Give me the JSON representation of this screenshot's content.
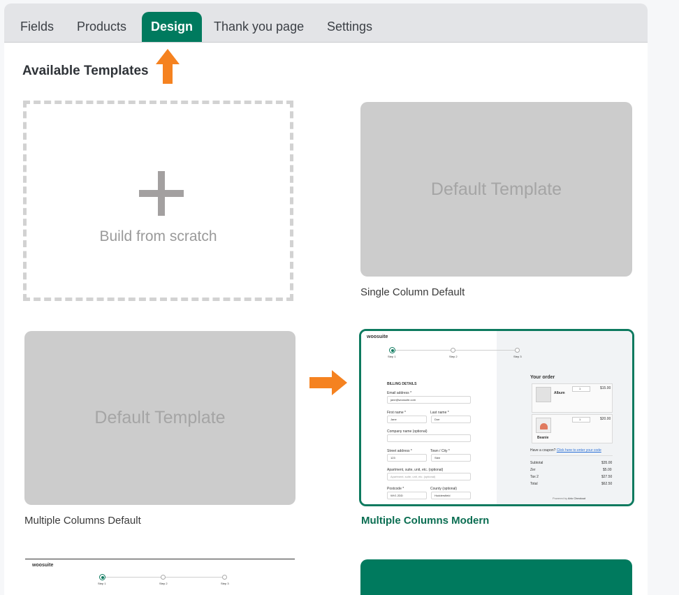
{
  "tabs": [
    {
      "label": "Fields"
    },
    {
      "label": "Products"
    },
    {
      "label": "Design"
    },
    {
      "label": "Thank you page"
    },
    {
      "label": "Settings"
    }
  ],
  "section_title": "Available Templates",
  "templates": {
    "scratch": {
      "label": "Build from scratch"
    },
    "single_default": {
      "placeholder": "Default Template",
      "caption": "Single Column Default"
    },
    "multi_default": {
      "placeholder": "Default Template",
      "caption": "Multiple Columns Default"
    },
    "multi_modern": {
      "caption": "Multiple Columns Modern"
    }
  },
  "preview": {
    "logo": "woosuite",
    "steps": [
      "Step 1",
      "Step 2",
      "Step 3"
    ],
    "billing_title": "BILLING DETAILS",
    "email_label": "Email address *",
    "email_value": "jane@woosuite.com",
    "first_label": "First name *",
    "first_value": "Jane",
    "last_label": "Last name *",
    "last_value": "Doe",
    "company_label": "Company name (optional)",
    "street_label": "Street address *",
    "street_value": "123",
    "town_label": "Town / City *",
    "town_value": "Stee",
    "apt_label": "Apartment, suite, unit, etc. (optional)",
    "apt_placeholder": "Apartment, suite, unit, etc. (optional)",
    "postcode_label": "Postcode *",
    "postcode_value": "WV1 2DD",
    "county_label": "County (optional)",
    "county_value": "Huddersfield",
    "order_title": "Your order",
    "item1_name": "Album",
    "item1_price": "$15.00",
    "item2_name": "Beanie",
    "item2_price": "$20.00",
    "qty": "1",
    "coupon_text": "Have a coupon?",
    "coupon_link": "Click here to enter your code",
    "subtotal_label": "Subtotal",
    "subtotal_value": "$35.00",
    "tax1_label": "Zer",
    "tax1_value": "$5.00",
    "tax2_label": "Tax 2",
    "tax2_value": "$27.50",
    "total_label": "Total",
    "total_value": "$62.50",
    "powered": "Powered by",
    "powered_brand": "Arlo Checkout"
  },
  "bottom_preview": {
    "logo": "woosuite",
    "steps": [
      "Step 1",
      "Step 2",
      "Step 3"
    ]
  },
  "colors": {
    "accent": "#007a5e",
    "arrow": "#f58220",
    "placeholder_bg": "#cccccc"
  }
}
